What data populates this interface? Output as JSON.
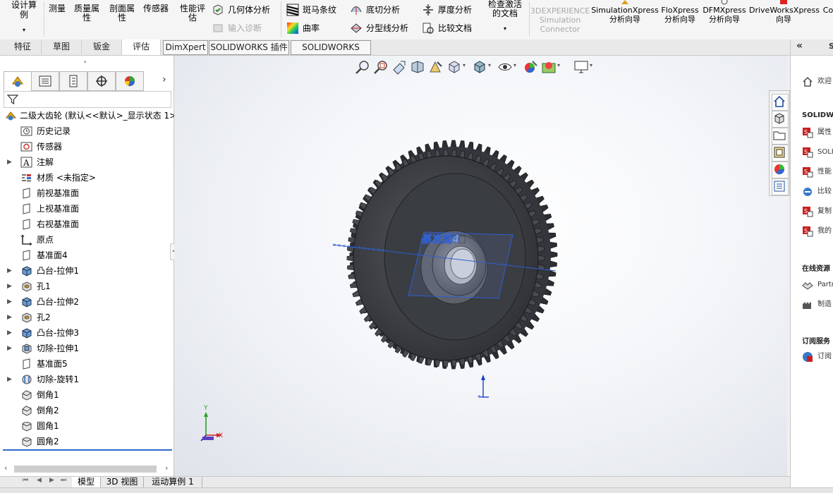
{
  "ribbon": {
    "design_study": "设计算例",
    "measure": "测量",
    "mass_properties": "质量属性",
    "section_properties": "剖面属性",
    "sensor": "传感器",
    "performance_evaluation": "性能评估",
    "geometry_analysis": "几何体分析",
    "input_diagnostics": "输入诊断",
    "zebra_stripes": "斑马条纹",
    "curvature": "曲率",
    "undercut_analysis": "底切分析",
    "parting_line_analysis": "分型线分析",
    "thickness_analysis": "厚度分析",
    "compare_documents": "比较文档",
    "check_active_document": "检查激活的文档",
    "sim_connector": "3DEXPERIENCE Simulation Connector",
    "simulationxpress": "SimulationXpress 分析向导",
    "floxpress": "FloXpress 分析向导",
    "dfmxpress": "DFMXpress 分析向导",
    "driveworksxpress": "DriveWorksXpress 向导",
    "cut_label": "Co"
  },
  "command_tabs": [
    "特征",
    "草图",
    "钣金",
    "评估",
    "DimXpert",
    "SOLIDWORKS 插件",
    "SOLIDWORKS MBD"
  ],
  "tree": {
    "root": "二级大齿轮 (默认<<默认>_显示状态 1>)",
    "items": [
      {
        "label": "历史记录",
        "icon": "history-icon",
        "expandable": false
      },
      {
        "label": "传感器",
        "icon": "sensor-icon",
        "expandable": false
      },
      {
        "label": "注解",
        "icon": "annotation-icon",
        "expandable": true
      },
      {
        "label": "材质 <未指定>",
        "icon": "material-icon",
        "expandable": false
      },
      {
        "label": "前视基准面",
        "icon": "plane-icon",
        "expandable": false
      },
      {
        "label": "上视基准面",
        "icon": "plane-icon",
        "expandable": false
      },
      {
        "label": "右视基准面",
        "icon": "plane-icon",
        "expandable": false
      },
      {
        "label": "原点",
        "icon": "origin-icon",
        "expandable": false
      },
      {
        "label": "基准面4",
        "icon": "plane-icon",
        "expandable": false
      },
      {
        "label": "凸台-拉伸1",
        "icon": "extrude-icon",
        "expandable": true
      },
      {
        "label": "孔1",
        "icon": "hole-icon",
        "expandable": true
      },
      {
        "label": "凸台-拉伸2",
        "icon": "extrude-icon",
        "expandable": true
      },
      {
        "label": "孔2",
        "icon": "hole-icon",
        "expandable": true
      },
      {
        "label": "凸台-拉伸3",
        "icon": "extrude-icon",
        "expandable": true
      },
      {
        "label": "切除-拉伸1",
        "icon": "cut-extrude-icon",
        "expandable": true
      },
      {
        "label": "基准面5",
        "icon": "plane-icon",
        "expandable": false
      },
      {
        "label": "切除-旋转1",
        "icon": "cut-revolve-icon",
        "expandable": true
      },
      {
        "label": "倒角1",
        "icon": "chamfer-icon",
        "expandable": false
      },
      {
        "label": "倒角2",
        "icon": "chamfer-icon",
        "expandable": false
      },
      {
        "label": "圆角1",
        "icon": "fillet-icon",
        "expandable": false
      },
      {
        "label": "圆角2",
        "icon": "fillet-icon",
        "expandable": false
      }
    ]
  },
  "viewport": {
    "plane_label": "基准面4",
    "triad": {
      "x": "X",
      "y": "Y"
    }
  },
  "bottom_tabs": [
    "模型",
    "3D 视图",
    "运动算例 1"
  ],
  "task_pane": {
    "welcome": "欢迎",
    "solidworks_section": "SOLIDWO",
    "items_a": [
      "属性",
      "SOLI",
      "性能",
      "比较",
      "复制",
      "我的"
    ],
    "online_section": "在线资源",
    "items_b": [
      "Partn",
      "制造"
    ],
    "subscription_section": "订阅服务",
    "items_c": [
      "订阅"
    ]
  },
  "colors": {
    "gear": "#3d3f44",
    "plane": "#2f5fd0",
    "accent": "#1f5fbf"
  }
}
